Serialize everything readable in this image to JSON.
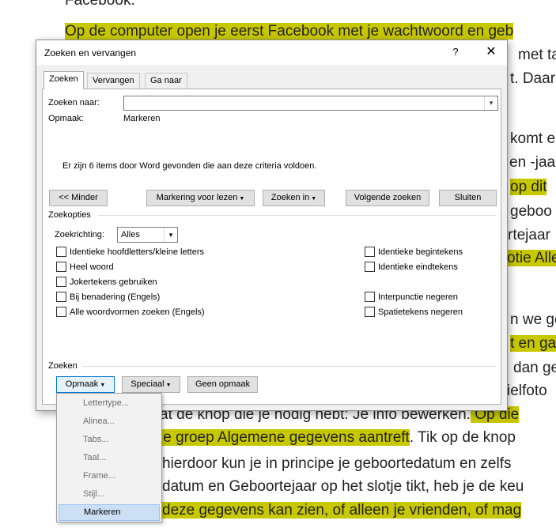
{
  "document": {
    "lines": [
      {
        "text": "Facebook.",
        "hl": false
      },
      {
        "text": "Op de computer open je eerst Facebook met je wachtwoord en geb",
        "hl": true
      },
      {
        "text": "met ta",
        "hl": false
      },
      {
        "text": "t. Daar",
        "hl": false
      },
      {
        "text": "komt e",
        "hl": false
      },
      {
        "text": "en -jaar",
        "hl": false
      },
      {
        "text": "op dit",
        "hl": true
      },
      {
        "text": "geboo",
        "hl": false
      },
      {
        "text": "rtejaar",
        "hl": false
      },
      {
        "text": "otie Alle",
        "hl": true
      },
      {
        "text": "n we ge",
        "hl": false
      },
      {
        "text": "t en ga",
        "hl": true
      },
      {
        "text": "dan ge",
        "hl": false
      },
      {
        "text": "ielfoto",
        "hl": false
      },
      {
        "text": "at de knop die je nodig hebt: Je info bewerken.",
        "hl": false
      },
      {
        "text": " Op die",
        "hl": true
      },
      {
        "text": "le groep Algemene gegevens aantreft",
        "hl": true
      },
      {
        "text": ". Tik op de knop",
        "hl": false
      },
      {
        "text": "hierdoor kun je in principe je geboortedatum en zelfs",
        "hl": false
      },
      {
        "text": "datum en Geboortejaar op het slotje tikt, heb je de keu",
        "hl": false
      },
      {
        "text": "deze gegevens kan zien, of alleen je vrienden, of mag",
        "hl": true
      }
    ]
  },
  "dialog": {
    "title": "Zoeken en vervangen",
    "help": "?",
    "close": "✕",
    "tabs": [
      "Zoeken",
      "Vervangen",
      "Ga naar"
    ],
    "find_label": "Zoeken naar:",
    "find_value": "",
    "format_label": "Opmaak:",
    "format_value": "Markeren",
    "result_message": "Er zijn 6 items door Word gevonden die aan deze criteria voldoen.",
    "buttons": {
      "less": "<< Minder",
      "reading_highlight": "Markering voor lezen",
      "find_in": "Zoeken in",
      "find_next": "Volgende zoeken",
      "close": "Sluiten"
    },
    "options_title": "Zoekopties",
    "direction_label": "Zoekrichting:",
    "direction_value": "Alles",
    "left_options": [
      "Identieke hoofdletters/kleine letters",
      "Heel woord",
      "Jokertekens gebruiken",
      "Bij benadering (Engels)",
      "Alle woordvormen zoeken (Engels)"
    ],
    "right_options": [
      "Identieke begintekens",
      "Identieke eindtekens",
      "Interpunctie negeren",
      "Spatietekens negeren"
    ],
    "search_section": "Zoeken",
    "bottom_buttons": {
      "format": "Opmaak",
      "special": "Speciaal",
      "no_format": "Geen opmaak"
    }
  },
  "format_menu": {
    "items": [
      "Lettertype...",
      "Alinea...",
      "Tabs...",
      "Taal...",
      "Frame...",
      "Stijl...",
      "Markeren"
    ],
    "selected": "Markeren"
  }
}
